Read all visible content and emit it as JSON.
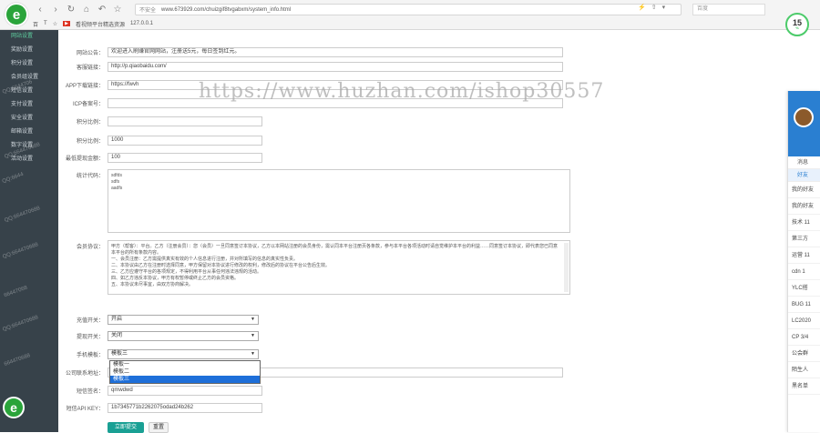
{
  "browser": {
    "back_icon": "back-arrow",
    "security_label": "不安全",
    "url": "www.673929.com/chuizgif8tvgabxm/system_info.html",
    "search_placeholder": "百度",
    "bookmarks": [
      "百",
      "T",
      "☆",
      "看视频平台精选资源",
      "127.0.0.1"
    ]
  },
  "sidebar": {
    "items": [
      {
        "label": "网站设置",
        "active": true
      },
      {
        "label": "奖励设置"
      },
      {
        "label": "积分设置"
      },
      {
        "label": "会员组设置"
      },
      {
        "label": "短信设置"
      },
      {
        "label": "支付设置"
      },
      {
        "label": "安全设置"
      },
      {
        "label": "邮箱设置"
      },
      {
        "label": "数字设置"
      },
      {
        "label": "活动设置"
      }
    ],
    "watermarks": [
      "QQ:6644706",
      "QQ:664470688",
      "QQ:6644",
      "QQ:664470688",
      "QQ:664470688",
      "66447068",
      "QQ:664470688",
      "664470688"
    ]
  },
  "form": {
    "rows": [
      {
        "label": "网站公告：",
        "value": "欢迎进入刷赚官网网站，注册送5元，每日签到红元。"
      },
      {
        "label": "客服链接：",
        "value": "http://p.qiaobaidu.com/"
      },
      {
        "label": "APP下载链接：",
        "value": "https://fwvh"
      },
      {
        "label": "ICP备案号：",
        "value": ""
      },
      {
        "label": "积分比例：",
        "value": ""
      },
      {
        "label": "积分比例：",
        "value": "1000"
      },
      {
        "label": "最低提现金额：",
        "value": "100"
      }
    ],
    "custom_label": "统计代码：",
    "custom_lines": [
      "sdfds",
      "sdfs",
      "aadfs"
    ],
    "agreement_label": "会员协议：",
    "agreement_text": "甲方（帮客）：平台。乙方（注册会员）：您（会员）一旦同意签订本协议，乙方以本网站注册的会员身份，需认同本平台注册页各条款，参与本平台各项活动时请自觉维护本平台的利益……同意签订本协议，即代表您已同意本平台的所有条款内容。<br> 一、会员注册：乙方需提供真实有效的个人信息进行注册，并对所填写的信息的真实性负责。<br> 二、本协议由乙方在注册时选择同意，甲方保留对本协议进行修改的权利，修改后的协议在平台公告后生效。<br> 三、乙方应遵守平台的各项规定，不得利用平台从事任何违法违规的活动。<br> 四、如乙方违反本协议，甲方有权暂停或终止乙方的会员资格。<br> 五、本协议未尽事宜，由双方协商解决。",
    "recharge_label": "充值开关：",
    "recharge_value": "开启",
    "withdraw_label": "提现开关：",
    "withdraw_value": "关闭",
    "template_label": "手机模板：",
    "template_value": "模板三",
    "template_options": [
      "模板一",
      "模板二",
      "模板三"
    ],
    "company_label": "公司联系地址：",
    "company_value": "",
    "sms_label": "短信签名：",
    "sms_value": "qmwdwd",
    "api_label": "短信API KEY：",
    "api_value": "1b7345771b2262075odad24b262",
    "save_button": "立即提交",
    "reset_button": "重置"
  },
  "watermark_text": "https://www.huzhan.com/ishop30557",
  "speed": {
    "value": "15",
    "unit": "%"
  },
  "right_panel": {
    "tabs": [
      "消息",
      "好友"
    ],
    "items": [
      "我的好友",
      "我的好友",
      "技术 11",
      "第三方",
      "运营 11",
      "cdn 1",
      "YLC搭",
      "BUG 11",
      "LC2020",
      "CP 3/4",
      "公会群",
      "陌生人",
      "黑名单"
    ]
  }
}
